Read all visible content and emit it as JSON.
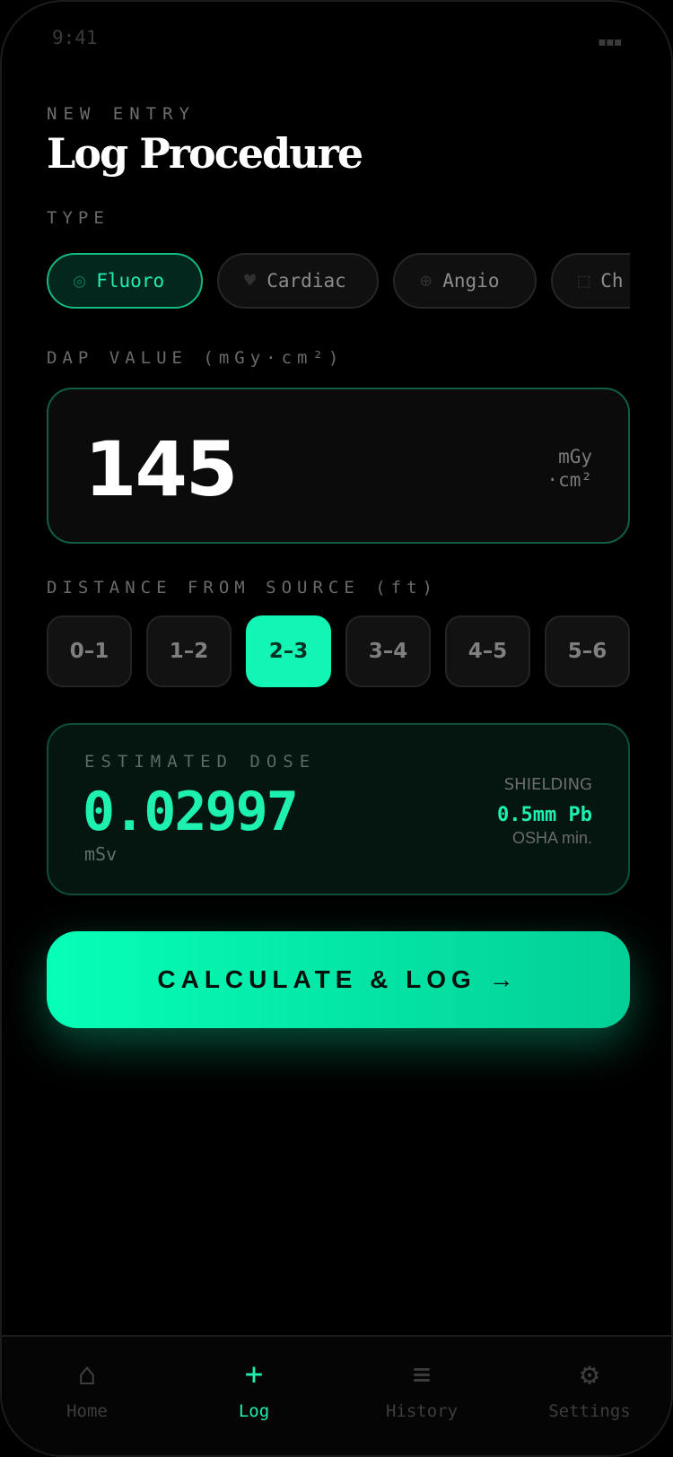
{
  "status": {
    "time": "9:41",
    "battery": "▪▪▪"
  },
  "header": {
    "eyebrow": "NEW ENTRY",
    "title": "Log Procedure"
  },
  "type_section": {
    "label": "TYPE",
    "chips": [
      {
        "icon": "◎",
        "label": "Fluoro",
        "active": true
      },
      {
        "icon": "♥",
        "label": "Cardiac",
        "active": false
      },
      {
        "icon": "⊕",
        "label": "Angio",
        "active": false
      },
      {
        "icon": "⬚",
        "label": "Ch",
        "active": false
      }
    ]
  },
  "dap": {
    "label": "DAP VALUE (mGy·cm²)",
    "value": "145",
    "unit_line1": "mGy",
    "unit_line2": "·cm²"
  },
  "distance": {
    "label": "DISTANCE FROM SOURCE (ft)",
    "options": [
      "0–1",
      "1–2",
      "2–3",
      "3–4",
      "4–5",
      "5–6"
    ],
    "selected": "2–3"
  },
  "dose": {
    "label": "ESTIMATED DOSE",
    "value": "0.02997",
    "unit": "mSv",
    "shielding_label": "SHIELDING",
    "shielding_value": "0.5mm Pb",
    "shielding_note": "OSHA min."
  },
  "cta": {
    "label": "CALCULATE & LOG →"
  },
  "tabs": [
    {
      "icon": "⌂",
      "label": "Home",
      "active": false
    },
    {
      "icon": "+",
      "label": "Log",
      "active": true
    },
    {
      "icon": "≡",
      "label": "History",
      "active": false
    },
    {
      "icon": "⚙",
      "label": "Settings",
      "active": false
    }
  ],
  "colors": {
    "accent": "#1ef0b0",
    "background": "#000000",
    "card": "#0b0b0b"
  }
}
